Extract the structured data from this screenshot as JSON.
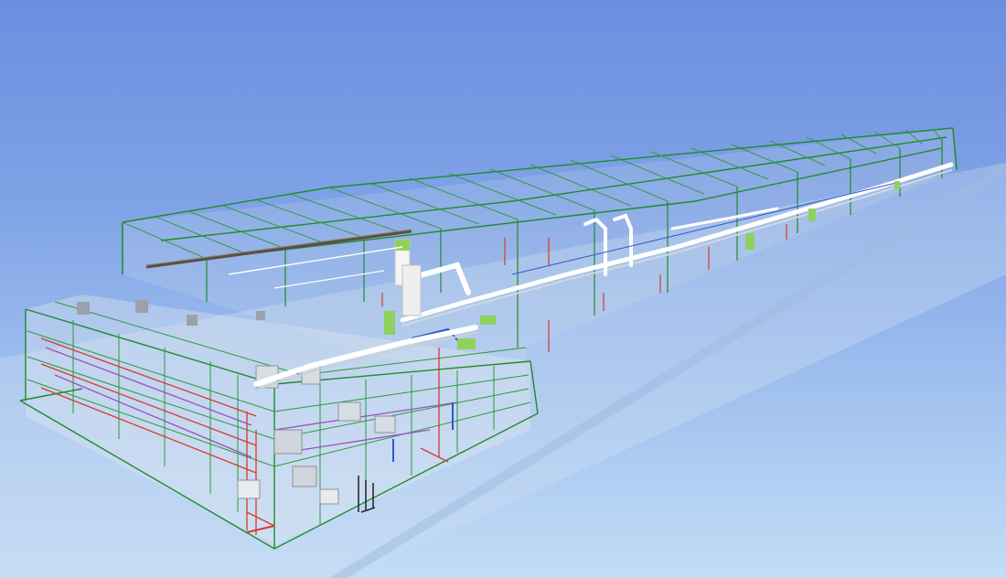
{
  "scene": {
    "model": "3d-mep-coordination-model",
    "background_top": "#6b8ee0",
    "background_bottom": "#c2ddf6",
    "colors": {
      "structure_frame": "#1f8a2e",
      "duct_main": "#ffffff",
      "duct_green": "#8fd15f",
      "pipe_red": "#d63a2a",
      "pipe_purple": "#9b4fb8",
      "pipe_blue": "#2f57c9",
      "pipe_brown": "#6a5a4a",
      "ground_plane": "#b5cdec",
      "glass_volume": "#d9e2ea"
    },
    "labels": []
  }
}
